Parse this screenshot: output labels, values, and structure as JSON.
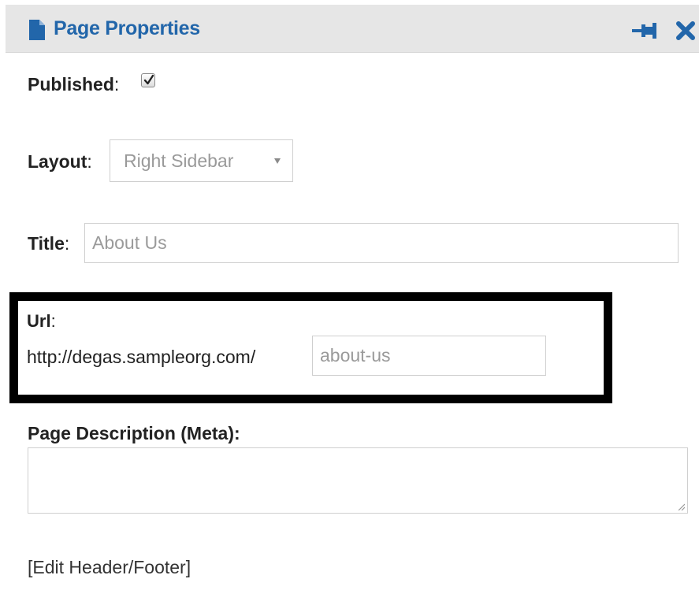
{
  "header": {
    "title": "Page Properties",
    "icons": {
      "document": "document-icon",
      "pin": "pin-icon",
      "close": "close-icon"
    },
    "accent_color": "#2266aa",
    "background_color": "#e6e6e6"
  },
  "published": {
    "label": "Published",
    "colon": ":",
    "checked": true
  },
  "layout": {
    "label": "Layout",
    "colon": ":",
    "selected": "Right Sidebar",
    "arrow_icon": "dropdown-arrow-icon"
  },
  "title_field": {
    "label": "Title",
    "colon": ":",
    "value": "About Us"
  },
  "url_field": {
    "label": "Url",
    "colon": ":",
    "prefix": "http://degas.sampleorg.com/",
    "value": "about-us",
    "highlight_color": "#000000"
  },
  "description_field": {
    "label": "Page Description (Meta):",
    "value": ""
  },
  "edit_header_footer": {
    "label": "[Edit Header/Footer]"
  }
}
